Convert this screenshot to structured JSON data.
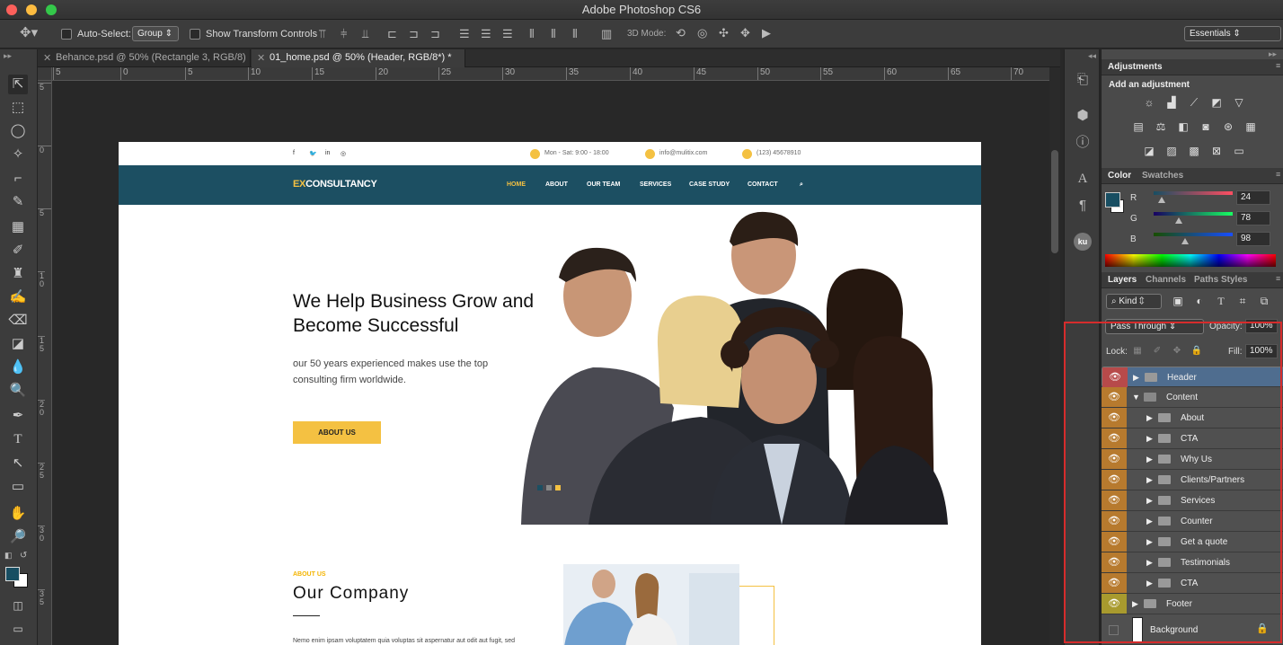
{
  "app": {
    "title": "Adobe Photoshop CS6"
  },
  "options": {
    "auto_select_label": "Auto-Select:",
    "auto_select_value": "Group",
    "transform_label": "Show Transform Controls",
    "mode3d_label": "3D Mode:",
    "workspace": "Essentials"
  },
  "tabs": [
    {
      "label": "Behance.psd @ 50% (Rectangle 3, RGB/8)"
    },
    {
      "label": "01_home.psd @ 50% (Header, RGB/8*) *"
    }
  ],
  "ruler_top": [
    "5",
    "0",
    "5",
    "10",
    "15",
    "20",
    "25",
    "30",
    "35",
    "40",
    "45",
    "50",
    "55",
    "60",
    "65",
    "70"
  ],
  "ruler_left": [
    "5",
    "0",
    "5",
    "1 0",
    "1 5",
    "2 0",
    "2 5",
    "3 0",
    "3 5"
  ],
  "site": {
    "hours": "Mon - Sat: 9:00 - 18:00",
    "email": "info@mulitix.com",
    "phone": "(123) 45678910",
    "logo_ex": "EX",
    "logo_rest": "CONSULTANCY",
    "nav": [
      "HOME",
      "ABOUT",
      "OUR TEAM",
      "SERVICES",
      "CASE STUDY",
      "CONTACT"
    ],
    "hero_title": "We Help Business Grow and Become Successful",
    "hero_sub": "our 50 years experienced makes use the top consulting firm worldwide.",
    "hero_btn": "ABOUT US",
    "about_tag": "ABOUT US",
    "about_title": "Our Company",
    "about_text": "Nemo enim ipsam voluptatem quia voluptas sit aspernatur aut odit aut fugit, sed"
  },
  "panels": {
    "adjustments_tab": "Adjustments",
    "add_adjustment": "Add an adjustment",
    "color_tab": "Color",
    "swatches_tab": "Swatches",
    "r_label": "R",
    "g_label": "G",
    "b_label": "B",
    "r": "24",
    "g": "78",
    "b": "98",
    "layers_tab": "Layers",
    "channels_tab": "Channels",
    "paths_tab": "Paths",
    "styles_tab": "Styles",
    "kind": "Kind",
    "blend_mode": "Pass Through",
    "opacity_label": "Opacity:",
    "opacity": "100%",
    "lock_label": "Lock:",
    "fill_label": "Fill:",
    "fill": "100%"
  },
  "layers": [
    {
      "name": "Header"
    },
    {
      "name": "Content"
    },
    {
      "name": "About"
    },
    {
      "name": "CTA"
    },
    {
      "name": "Why Us"
    },
    {
      "name": "Clients/Partners"
    },
    {
      "name": "Services"
    },
    {
      "name": "Counter"
    },
    {
      "name": "Get a quote"
    },
    {
      "name": "Testimonials"
    },
    {
      "name": "CTA"
    },
    {
      "name": "Footer"
    },
    {
      "name": "Background"
    }
  ],
  "colors": {
    "foreground": "#184e62",
    "accent": "#f4c142",
    "highlight": "#d62c2c"
  }
}
